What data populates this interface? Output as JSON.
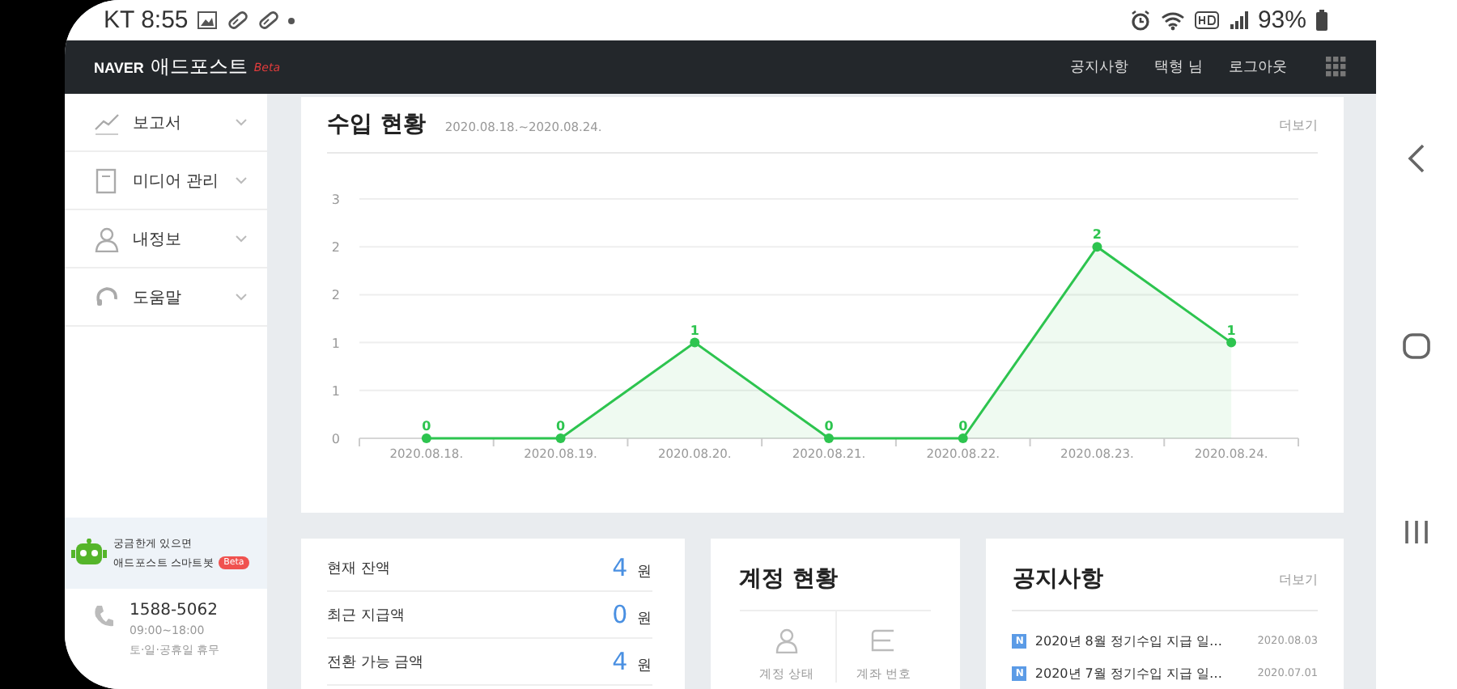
{
  "status_bar": {
    "carrier_time": "KT 8:55",
    "battery": "93%"
  },
  "header": {
    "logo": "NAVER",
    "title": "애드포스트",
    "badge": "Beta",
    "links": [
      "공지사항",
      "택형 님",
      "로그아웃"
    ]
  },
  "sidebar": {
    "items": [
      {
        "label": "보고서"
      },
      {
        "label": "미디어 관리"
      },
      {
        "label": "내정보"
      },
      {
        "label": "도움말"
      }
    ],
    "chatbot": {
      "lines": [
        "궁금한게 있으면",
        "애드포스트 스마트봇"
      ],
      "badge": "Beta"
    },
    "support": {
      "phone": "1588-5062",
      "hours": "09:00~18:00",
      "closed": "토·일·공휴일 휴무"
    }
  },
  "income": {
    "title": "수입 현황",
    "period": "2020.08.18.~2020.08.24.",
    "more": "더보기",
    "chart_data": {
      "type": "line",
      "categories": [
        "2020.08.18.",
        "2020.08.19.",
        "2020.08.20.",
        "2020.08.21.",
        "2020.08.22.",
        "2020.08.23.",
        "2020.08.24."
      ],
      "series": [
        {
          "color": "#2dc44f",
          "marker": "circle",
          "values": [
            0,
            0,
            1,
            0,
            0,
            2,
            1
          ]
        }
      ],
      "grid": true,
      "ylim": [
        0,
        2.5
      ],
      "yticks": [
        {
          "value": 0,
          "label": "0"
        },
        {
          "value": 0.5,
          "label": "1"
        },
        {
          "value": 1,
          "label": "1"
        },
        {
          "value": 1.5,
          "label": "2"
        },
        {
          "value": 2,
          "label": "2"
        },
        {
          "value": 2.5,
          "label": "3"
        }
      ],
      "data_labels": true
    }
  },
  "balance": {
    "rows": [
      {
        "label": "현재 잔액",
        "amount": "4",
        "unit": "원"
      },
      {
        "label": "최근 지급액",
        "amount": "0",
        "unit": "원"
      },
      {
        "label": "전환 가능 금액",
        "amount": "4",
        "unit": "원"
      }
    ]
  },
  "account": {
    "title": "계정 현황",
    "items": [
      {
        "label": "계정 상태"
      },
      {
        "label": "계좌 번호"
      }
    ]
  },
  "notices": {
    "title": "공지사항",
    "more": "더보기",
    "items": [
      {
        "badge": "N",
        "title": "2020년 8월 정기수입 지급 일…",
        "date": "2020.08.03"
      },
      {
        "badge": "N",
        "title": "2020년 7월 정기수입 지급 일…",
        "date": "2020.07.01"
      }
    ]
  }
}
